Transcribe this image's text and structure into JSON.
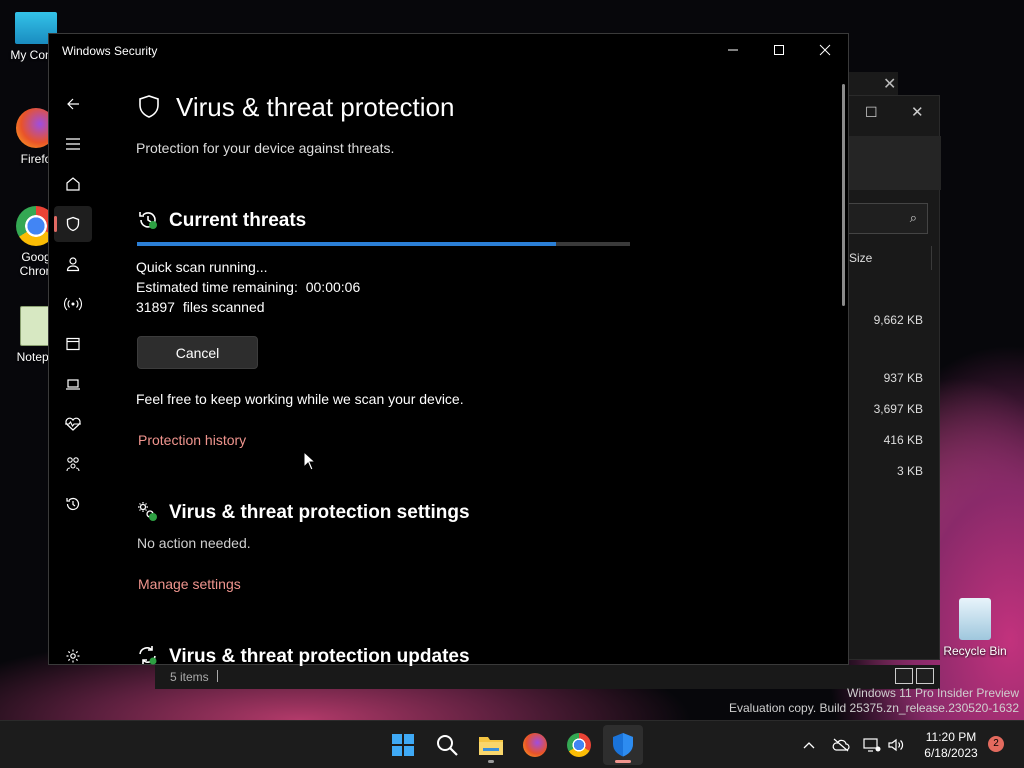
{
  "desktop": {
    "icons": [
      {
        "label": "My Comp",
        "icon": "computer-icon"
      },
      {
        "label": "Firefo",
        "icon": "firefox-icon"
      },
      {
        "label": "Goog Chron",
        "icon": "chrome-icon"
      },
      {
        "label": "Notepa",
        "icon": "notepad-icon"
      },
      {
        "label": "Recycle Bin",
        "icon": "recycle-bin-icon"
      }
    ],
    "watermark": {
      "line1": "Windows 11 Pro Insider Preview",
      "line2": "Evaluation copy. Build 25375.zn_release.230520-1632"
    }
  },
  "explorer": {
    "size_header": "Size",
    "sizes": [
      "9,662 KB",
      "937 KB",
      "3,697 KB",
      "416 KB",
      "3 KB"
    ],
    "status": "5 items"
  },
  "window": {
    "title": "Windows Security",
    "page_title": "Virus & threat protection",
    "page_subtitle": "Protection for your device against threats.",
    "current_threats": {
      "heading": "Current threats",
      "progress": 0.85,
      "status": "Quick scan running...",
      "eta_label": "Estimated time remaining:",
      "eta_value": "00:00:06",
      "files_count": "31897",
      "files_label": "files scanned",
      "cancel_label": "Cancel",
      "note": "Feel free to keep working while we scan your device.",
      "history_link": "Protection history"
    },
    "settings": {
      "heading": "Virus & threat protection settings",
      "status": "No action needed.",
      "manage_link": "Manage settings"
    },
    "updates": {
      "heading": "Virus & threat protection updates"
    }
  },
  "taskbar": {
    "apps": [
      "start-icon",
      "search-icon",
      "file-explorer-icon",
      "firefox-icon",
      "chrome-icon",
      "windows-security-icon"
    ],
    "time": "11:20 PM",
    "date": "6/18/2023",
    "notification_count": "2"
  },
  "colors": {
    "accent_link": "#f0958e",
    "progress": "#2b7fd6",
    "active_indicator": "#e06a63"
  }
}
